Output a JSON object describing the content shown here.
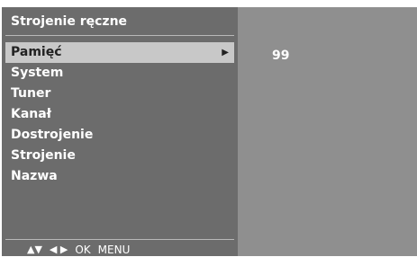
{
  "title": "Strojenie ręczne",
  "menu": {
    "items": [
      {
        "label": "Pamięć",
        "selected": true,
        "arrow": "▶"
      },
      {
        "label": "System"
      },
      {
        "label": "Tuner"
      },
      {
        "label": "Kanał"
      },
      {
        "label": "Dostrojenie"
      },
      {
        "label": "Strojenie"
      },
      {
        "label": "Nazwa"
      }
    ]
  },
  "value_panel": {
    "value": "99"
  },
  "hint_bar": {
    "up_down": "▲▼",
    "left_right": "◀ ▶",
    "ok": "OK",
    "menu": "MENU"
  },
  "colors": {
    "panel_bg": "#6c6c6c",
    "value_bg": "#8f8f8f",
    "selected_bg": "#c8c8c8",
    "text": "#ffffff"
  }
}
